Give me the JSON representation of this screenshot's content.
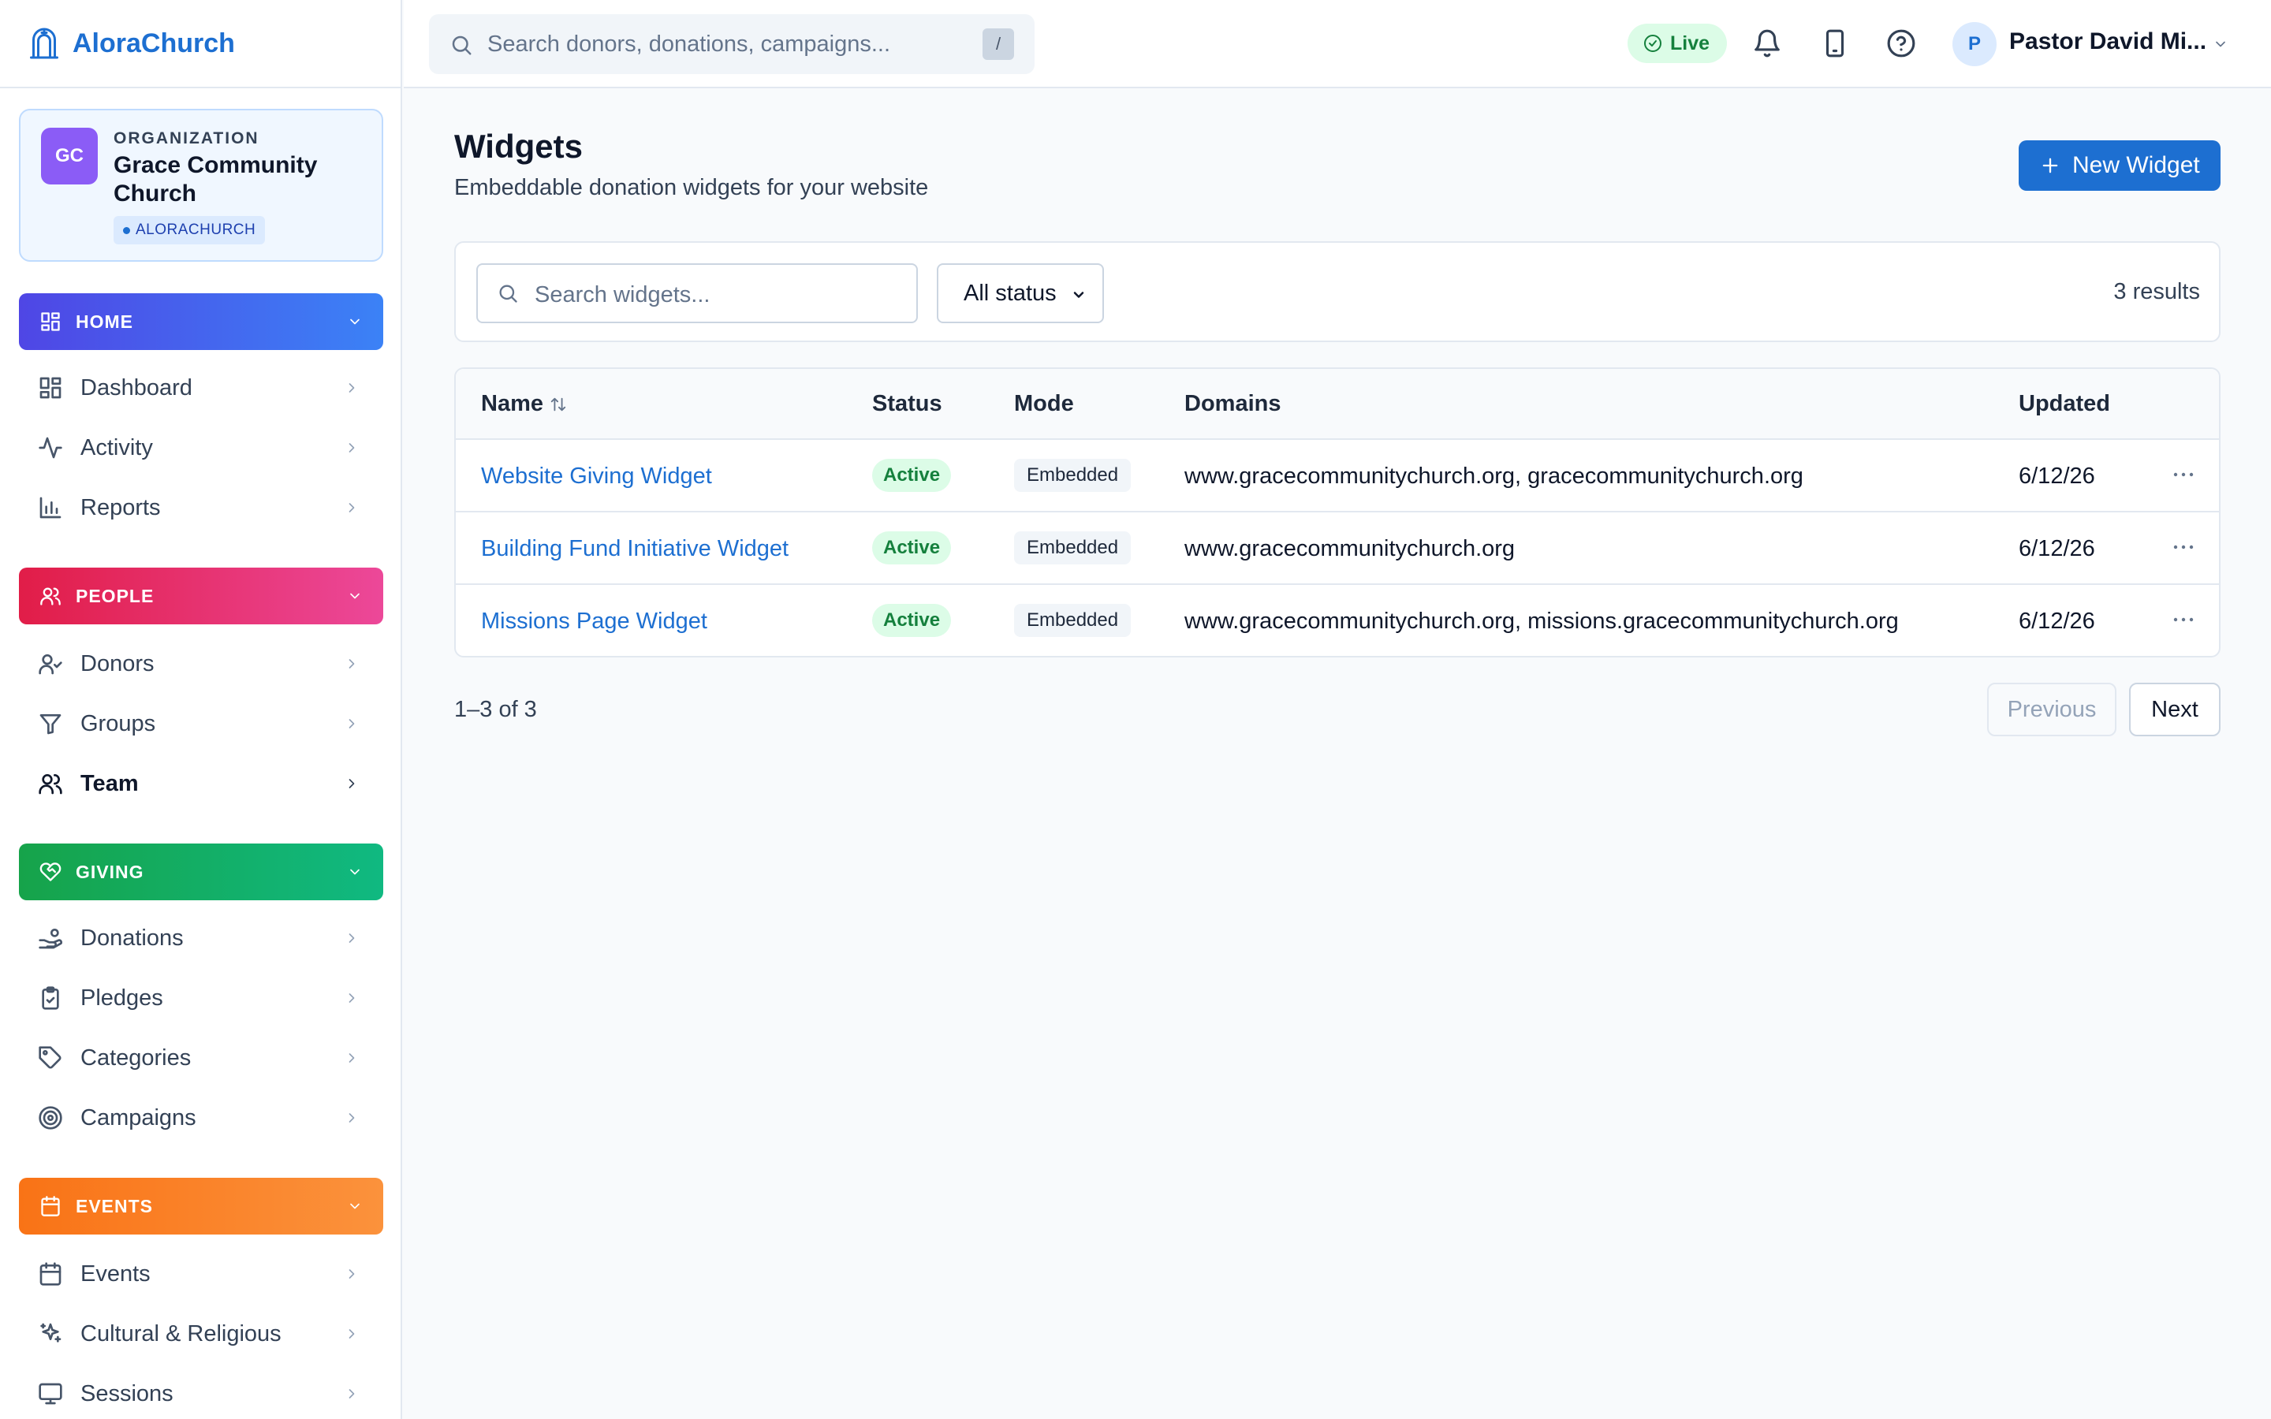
{
  "app": {
    "name": "AloraChurch"
  },
  "org": {
    "label": "ORGANIZATION",
    "initials": "GC",
    "name": "Grace Community Church",
    "tag": "ALORACHURCH"
  },
  "sidebar": {
    "sections": [
      {
        "label": "HOME",
        "color_from": "#4f46e5",
        "color_to": "#3b82f6",
        "items": [
          {
            "label": "Dashboard",
            "icon": "dashboard-icon"
          },
          {
            "label": "Activity",
            "icon": "activity-icon"
          },
          {
            "label": "Reports",
            "icon": "reports-icon"
          }
        ]
      },
      {
        "label": "PEOPLE",
        "color_from": "#e11d48",
        "color_to": "#ec4899",
        "items": [
          {
            "label": "Donors",
            "icon": "donors-icon"
          },
          {
            "label": "Groups",
            "icon": "groups-icon"
          },
          {
            "label": "Team",
            "icon": "team-icon",
            "active": true
          }
        ]
      },
      {
        "label": "GIVING",
        "color_from": "#16a34a",
        "color_to": "#10b981",
        "items": [
          {
            "label": "Donations",
            "icon": "donations-icon"
          },
          {
            "label": "Pledges",
            "icon": "pledges-icon"
          },
          {
            "label": "Categories",
            "icon": "categories-icon"
          },
          {
            "label": "Campaigns",
            "icon": "campaigns-icon"
          }
        ]
      },
      {
        "label": "EVENTS",
        "color_from": "#f97316",
        "color_to": "#fb923c",
        "items": [
          {
            "label": "Events",
            "icon": "events-icon"
          },
          {
            "label": "Cultural & Religious",
            "icon": "cultural-icon"
          },
          {
            "label": "Sessions",
            "icon": "sessions-icon"
          }
        ]
      }
    ]
  },
  "topbar": {
    "search_placeholder": "Search donors, donations, campaigns...",
    "search_shortcut": "/",
    "live_label": "Live",
    "user_initial": "P",
    "user_name": "Pastor David Mi..."
  },
  "page": {
    "title": "Widgets",
    "subtitle": "Embeddable donation widgets for your website",
    "new_button": "New Widget"
  },
  "filters": {
    "search_placeholder": "Search widgets...",
    "status_value": "All status",
    "results": "3 results"
  },
  "table": {
    "headers": {
      "name": "Name",
      "status": "Status",
      "mode": "Mode",
      "domains": "Domains",
      "updated": "Updated"
    },
    "rows": [
      {
        "name": "Website Giving Widget",
        "status": "Active",
        "mode": "Embedded",
        "domains": "www.gracecommunitychurch.org, gracecommunitychurch.org",
        "updated": "6/12/26"
      },
      {
        "name": "Building Fund Initiative Widget",
        "status": "Active",
        "mode": "Embedded",
        "domains": "www.gracecommunitychurch.org",
        "updated": "6/12/26"
      },
      {
        "name": "Missions Page Widget",
        "status": "Active",
        "mode": "Embedded",
        "domains": "www.gracecommunitychurch.org, missions.gracecommunitychurch.org",
        "updated": "6/12/26"
      }
    ]
  },
  "pager": {
    "info": "1–3 of 3",
    "previous": "Previous",
    "next": "Next"
  },
  "colors": {
    "brand": "#1d6fd1",
    "active_badge": "#dcfce7"
  }
}
